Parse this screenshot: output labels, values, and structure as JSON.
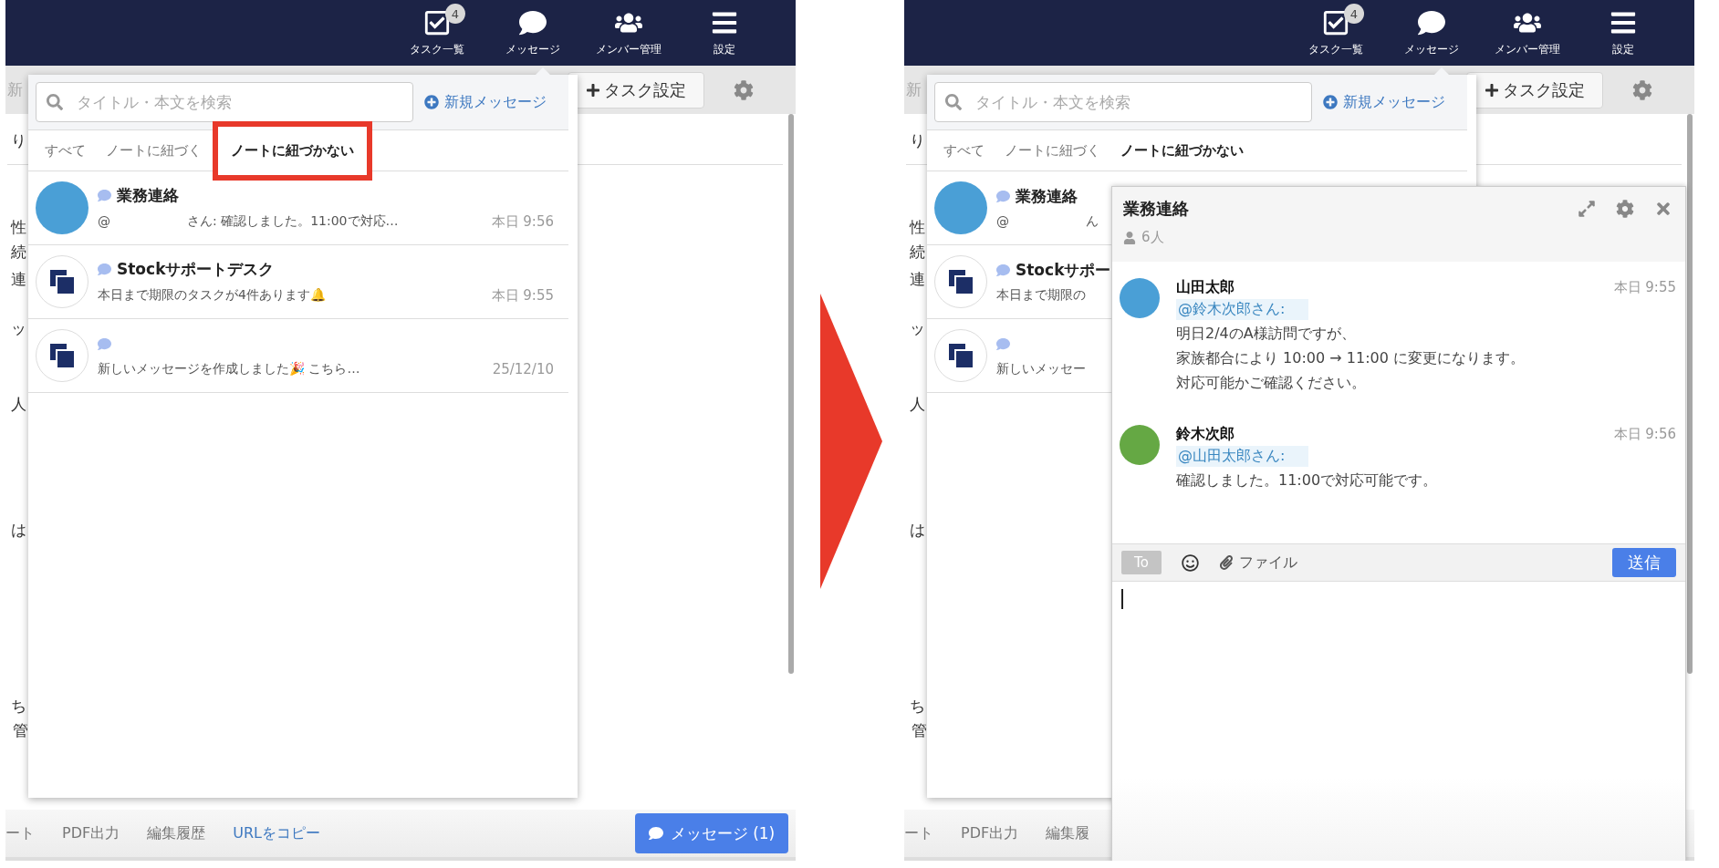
{
  "screens": [
    {
      "header": {
        "nav": [
          {
            "label": "タスク一覧",
            "badge": "4"
          },
          {
            "label": "メッセージ"
          },
          {
            "label": "メンバー管理"
          },
          {
            "label": "設定"
          }
        ]
      },
      "toolbar": {
        "fragment": "新",
        "task_button": "タスク設定"
      },
      "page_fragments": [
        "り",
        "性",
        "続",
        "連",
        "ッ",
        "人",
        "は",
        "ち",
        "管"
      ],
      "dropdown": {
        "search_placeholder": "タイトル・本文を検索",
        "new_message": "新規メッセージ",
        "tabs": [
          {
            "label": "すべて",
            "selected": false,
            "highlighted": false
          },
          {
            "label": "ノートに紐づく",
            "selected": false,
            "highlighted": false
          },
          {
            "label": "ノートに紐づかない",
            "selected": true,
            "highlighted": true
          }
        ],
        "items": [
          {
            "kind": "color",
            "color": "#4a9fd6",
            "title": "業務連絡",
            "preview": [
              "@",
              "さん: 確認しました。11:00で対応…"
            ],
            "time": "本日 9:56"
          },
          {
            "kind": "logo",
            "title": "Stockサポートデスク",
            "preview": [
              "本日まで期限のタスクが4件あります🔔"
            ],
            "time": "本日 9:55"
          },
          {
            "kind": "logo",
            "preview": [
              "新しいメッセージを作成しました🎉 こちら…"
            ],
            "time": "25/12/10"
          }
        ]
      },
      "footer": {
        "links": [
          {
            "label": "ート",
            "kind": "plain"
          },
          {
            "label": "PDF出力",
            "kind": "plain"
          },
          {
            "label": "編集履歴",
            "kind": "plain"
          },
          {
            "label": "URLをコピー",
            "kind": "link"
          }
        ],
        "message_button": "メッセージ (1)"
      }
    },
    {
      "header": {
        "nav": [
          {
            "label": "タスク一覧",
            "badge": "4"
          },
          {
            "label": "メッセージ"
          },
          {
            "label": "メンバー管理"
          },
          {
            "label": "設定"
          }
        ]
      },
      "toolbar": {
        "fragment": "新",
        "task_button": "タスク設定"
      },
      "page_fragments": [
        "り",
        "性",
        "続",
        "連",
        "ッ",
        "人",
        "は",
        "ち",
        "管"
      ],
      "dropdown": {
        "search_placeholder": "タイトル・本文を検索",
        "new_message": "新規メッセージ",
        "tabs": [
          {
            "label": "すべて",
            "selected": false,
            "highlighted": false
          },
          {
            "label": "ノートに紐づく",
            "selected": false,
            "highlighted": false
          },
          {
            "label": "ノートに紐づかない",
            "selected": true,
            "highlighted": false
          }
        ],
        "items": [
          {
            "kind": "color",
            "color": "#4a9fd6",
            "title": "業務連絡",
            "preview": [
              "@",
              "ん"
            ]
          },
          {
            "kind": "logo",
            "title": "Stockサポー",
            "preview": [
              "本日まで期限の"
            ]
          },
          {
            "kind": "logo",
            "preview": [
              "新しいメッセー"
            ]
          }
        ]
      },
      "footer": {
        "links": [
          {
            "label": "ート",
            "kind": "plain"
          },
          {
            "label": "PDF出力",
            "kind": "plain"
          },
          {
            "label": "編集履",
            "kind": "plain"
          }
        ]
      },
      "chat": {
        "title": "業務連絡",
        "members": "6人",
        "composer": {
          "to": "To",
          "file": "ファイル",
          "send": "送信"
        },
        "messages": [
          {
            "name": "山田太郎",
            "color": "#4a9fd6",
            "time": "本日 9:55",
            "mention": "@鈴木次郎さん:",
            "body": [
              "明日2/4のA様訪問ですが、",
              "家族都合により 10:00 → 11:00 に変更になります。",
              "対応可能かご確認ください。"
            ]
          },
          {
            "name": "鈴木次郎",
            "color": "#65a844",
            "time": "本日 9:56",
            "mention": "@山田太郎さん:",
            "body": [
              "確認しました。11:00で対応可能です。"
            ]
          }
        ]
      }
    }
  ]
}
